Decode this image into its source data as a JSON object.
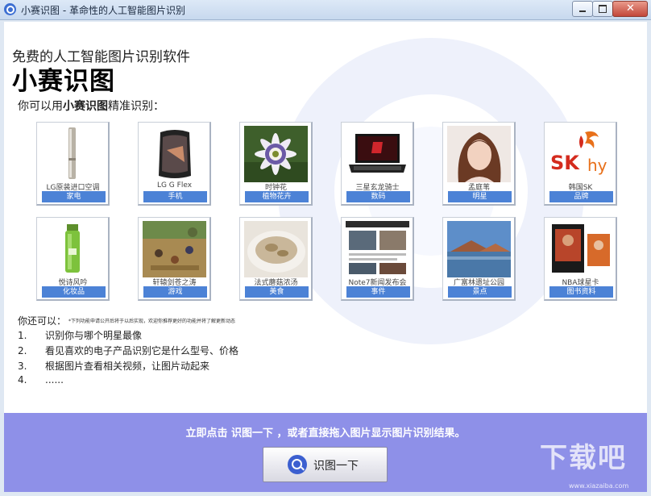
{
  "window": {
    "title": "小赛识图 - 革命性的人工智能图片识别"
  },
  "header": {
    "subtitle": "免费的人工智能图片识别软件",
    "app_name": "小赛识图"
  },
  "intro": {
    "prefix": "你可以用",
    "brand": "小赛识图",
    "suffix": "精准识别："
  },
  "cards": [
    {
      "caption": "LG原装进口空调",
      "category": "家电",
      "icon": "air-conditioner-image"
    },
    {
      "caption": "LG G Flex",
      "category": "手机",
      "icon": "smartphone-image"
    },
    {
      "caption": "时钟花",
      "category": "植物花卉",
      "icon": "flower-image"
    },
    {
      "caption": "三星玄龙骑士",
      "category": "数码",
      "icon": "laptop-image"
    },
    {
      "caption": "孟庭苇",
      "category": "明星",
      "icon": "portrait-image"
    },
    {
      "caption": "韩国SK",
      "category": "品牌",
      "icon": "logo-image"
    },
    {
      "caption": "悦诗风吟",
      "category": "化妆品",
      "icon": "cosmetic-bottle-image"
    },
    {
      "caption": "轩辕剑苍之涛",
      "category": "游戏",
      "icon": "game-scene-image"
    },
    {
      "caption": "法式蘑菇浓汤",
      "category": "美食",
      "icon": "soup-bowl-image"
    },
    {
      "caption": "Note7新闻发布会",
      "category": "事件",
      "icon": "webpage-image"
    },
    {
      "caption": "广富林遗址公园",
      "category": "景点",
      "icon": "park-scene-image"
    },
    {
      "caption": "NBA球星卡",
      "category": "图书资料",
      "icon": "trading-card-image"
    }
  ],
  "more": {
    "label": "你还可以：",
    "note": "*下列功能申请公开后将于以后实现，欢迎你推荐更好的功能并将了解更新动态",
    "items": [
      {
        "num": "1.",
        "text": "识别你与哪个明星最像"
      },
      {
        "num": "2.",
        "text": "看见喜欢的电子产品识别它是什么型号、价格"
      },
      {
        "num": "3.",
        "text": "根据图片查看相关视频，让图片动起来"
      },
      {
        "num": "4.",
        "text": "......"
      }
    ]
  },
  "bottom": {
    "message": "立即点击 识图一下 ，或者直接拖入图片显示图片识别结果。",
    "button_label": "识图一下"
  },
  "watermark": {
    "site": "下载吧",
    "url": "www.xiazaiba.com"
  },
  "colors": {
    "accent": "#4c82d6",
    "bottom_bar": "#8e90e8",
    "close": "#c2473a"
  }
}
